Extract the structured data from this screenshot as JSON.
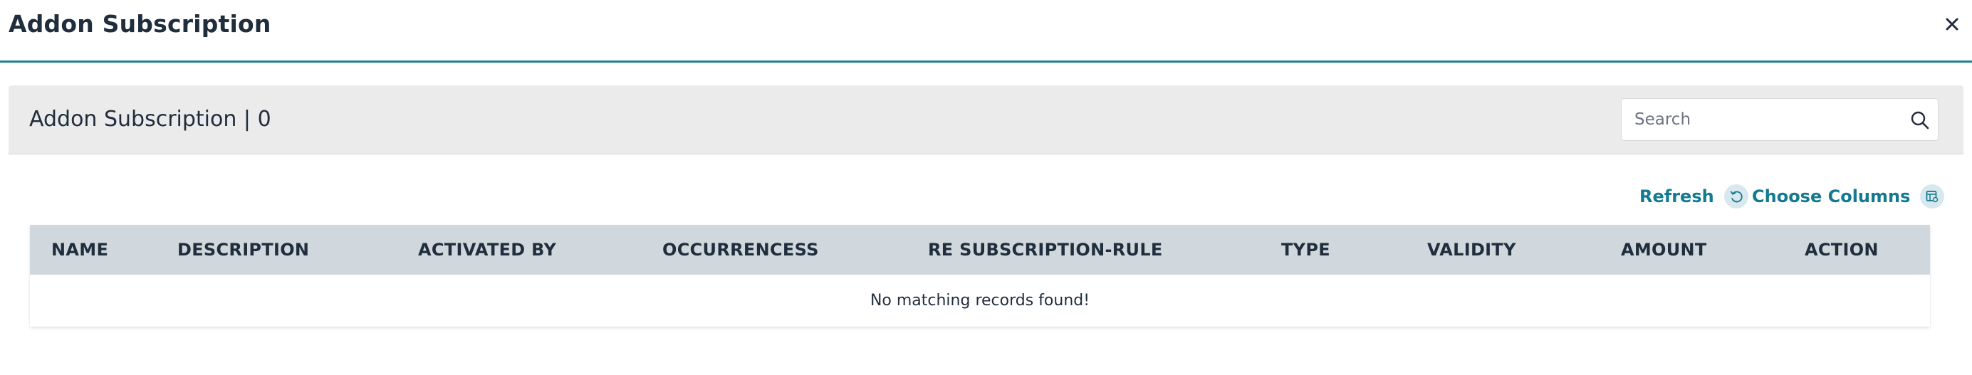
{
  "modal": {
    "title": "Addon Subscription",
    "close_symbol": "×"
  },
  "panel": {
    "title": "Addon Subscription | 0",
    "search": {
      "placeholder": "Search",
      "value": "",
      "icon": "search-icon"
    }
  },
  "toolbar": {
    "refresh_label": "Refresh",
    "refresh_icon": "refresh-icon",
    "choose_columns_label": "Choose Columns",
    "choose_columns_icon": "columns-icon"
  },
  "table": {
    "columns": [
      "NAME",
      "DESCRIPTION",
      "ACTIVATED BY",
      "OCCURRENCESS",
      "RE SUBSCRIPTION-RULE",
      "TYPE",
      "VALIDITY",
      "AMOUNT",
      "ACTION"
    ],
    "rows": [],
    "empty_message": "No matching records found!"
  },
  "colors": {
    "accent": "#137a91",
    "header_rule": "#1a7f96",
    "table_header_bg": "#d1d8dd",
    "panel_bg": "#ebebeb"
  }
}
